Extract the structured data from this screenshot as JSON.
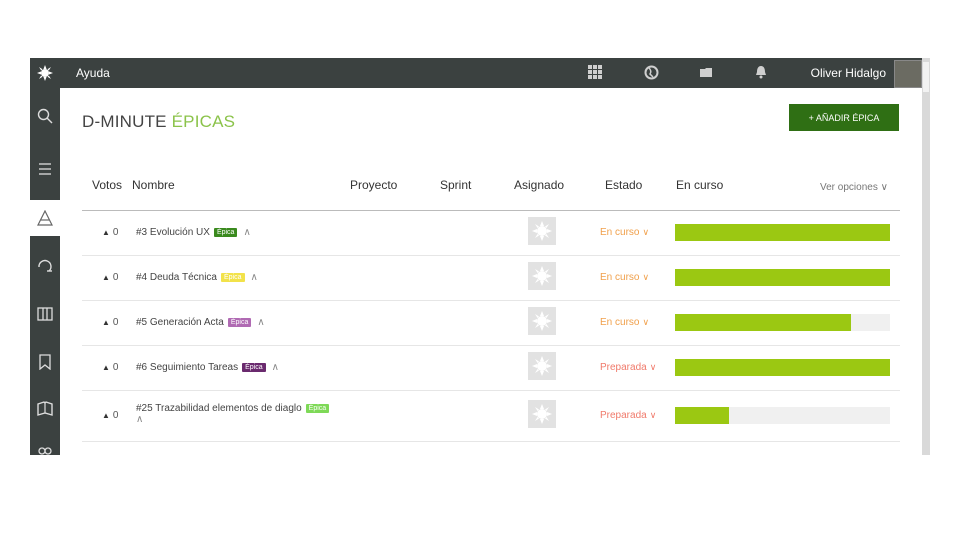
{
  "topbar": {
    "help_label": "Ayuda",
    "user_name": "Oliver Hidalgo",
    "icons": [
      "logo-icon",
      "apps-grid-icon",
      "world-icon",
      "folder-icon",
      "bell-icon"
    ]
  },
  "sidebar": {
    "items": [
      {
        "icon": "search-icon"
      },
      {
        "icon": "menu-icon"
      },
      {
        "icon": "epics-icon",
        "active": true
      },
      {
        "icon": "refresh-icon"
      },
      {
        "icon": "columns-icon"
      },
      {
        "icon": "bookmark-icon"
      },
      {
        "icon": "book-icon"
      },
      {
        "icon": "team-icon"
      }
    ]
  },
  "page": {
    "title_prefix": "D-MINUTE",
    "title_accent": "ÉPICAS",
    "add_button": "+ AÑADIR ÉPICA",
    "view_options": "Ver opciones"
  },
  "table": {
    "headers": {
      "votes": "Votos",
      "name": "Nombre",
      "project": "Proyecto",
      "sprint": "Sprint",
      "assigned": "Asignado",
      "status": "Estado",
      "progress": "En curso"
    },
    "rows": [
      {
        "votes": "0",
        "name": "#3 Evolución UX",
        "tag": "Épica",
        "tag_color": "#3a8a1e",
        "status": "En curso",
        "status_color": "#f0a04b",
        "progress": 1.0
      },
      {
        "votes": "0",
        "name": "#4 Deuda Técnica",
        "tag": "Épica",
        "tag_color": "#f2e24a",
        "status": "En curso",
        "status_color": "#f0a04b",
        "progress": 1.0
      },
      {
        "votes": "0",
        "name": "#5 Generación Acta",
        "tag": "Épica",
        "tag_color": "#b06ab3",
        "status": "En curso",
        "status_color": "#f0a04b",
        "progress": 0.82
      },
      {
        "votes": "0",
        "name": "#6 Seguimiento Tareas",
        "tag": "Épica",
        "tag_color": "#6a2a6e",
        "status": "Preparada",
        "status_color": "#f07a6b",
        "progress": 1.0
      },
      {
        "votes": "0",
        "name": "#25 Trazabilidad elementos de diaglo",
        "tag": "Épica",
        "tag_color": "#7ed957",
        "status": "Preparada",
        "status_color": "#f07a6b",
        "progress": 0.25
      }
    ]
  },
  "colors": {
    "topbar": "#3b4140",
    "accent": "#8bc34a",
    "primary_button": "#2f6f14",
    "progress_fill": "#9bc812"
  }
}
